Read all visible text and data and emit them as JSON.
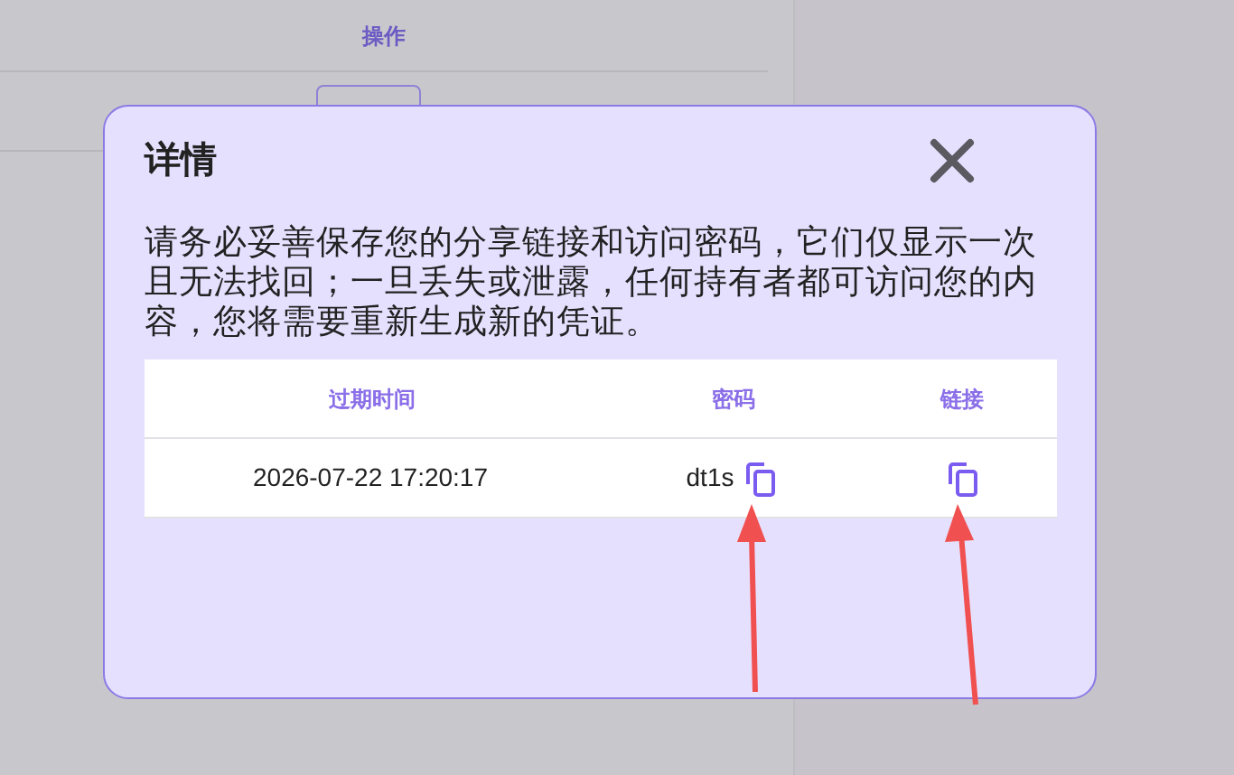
{
  "background_table": {
    "column_header": "操作"
  },
  "dialog": {
    "title": "详情",
    "notice": "请务必妥善保存您的分享链接和访问密码，它们仅显示一次且无法找回；一旦丢失或泄露，任何持有者都可访问您的内容，您将需要重新生成新的凭证。",
    "table": {
      "columns": [
        "过期时间",
        "密码",
        "链接"
      ],
      "rows": [
        {
          "expires": "2026-07-22 17:20:17",
          "password": "dt1s"
        }
      ]
    }
  }
}
